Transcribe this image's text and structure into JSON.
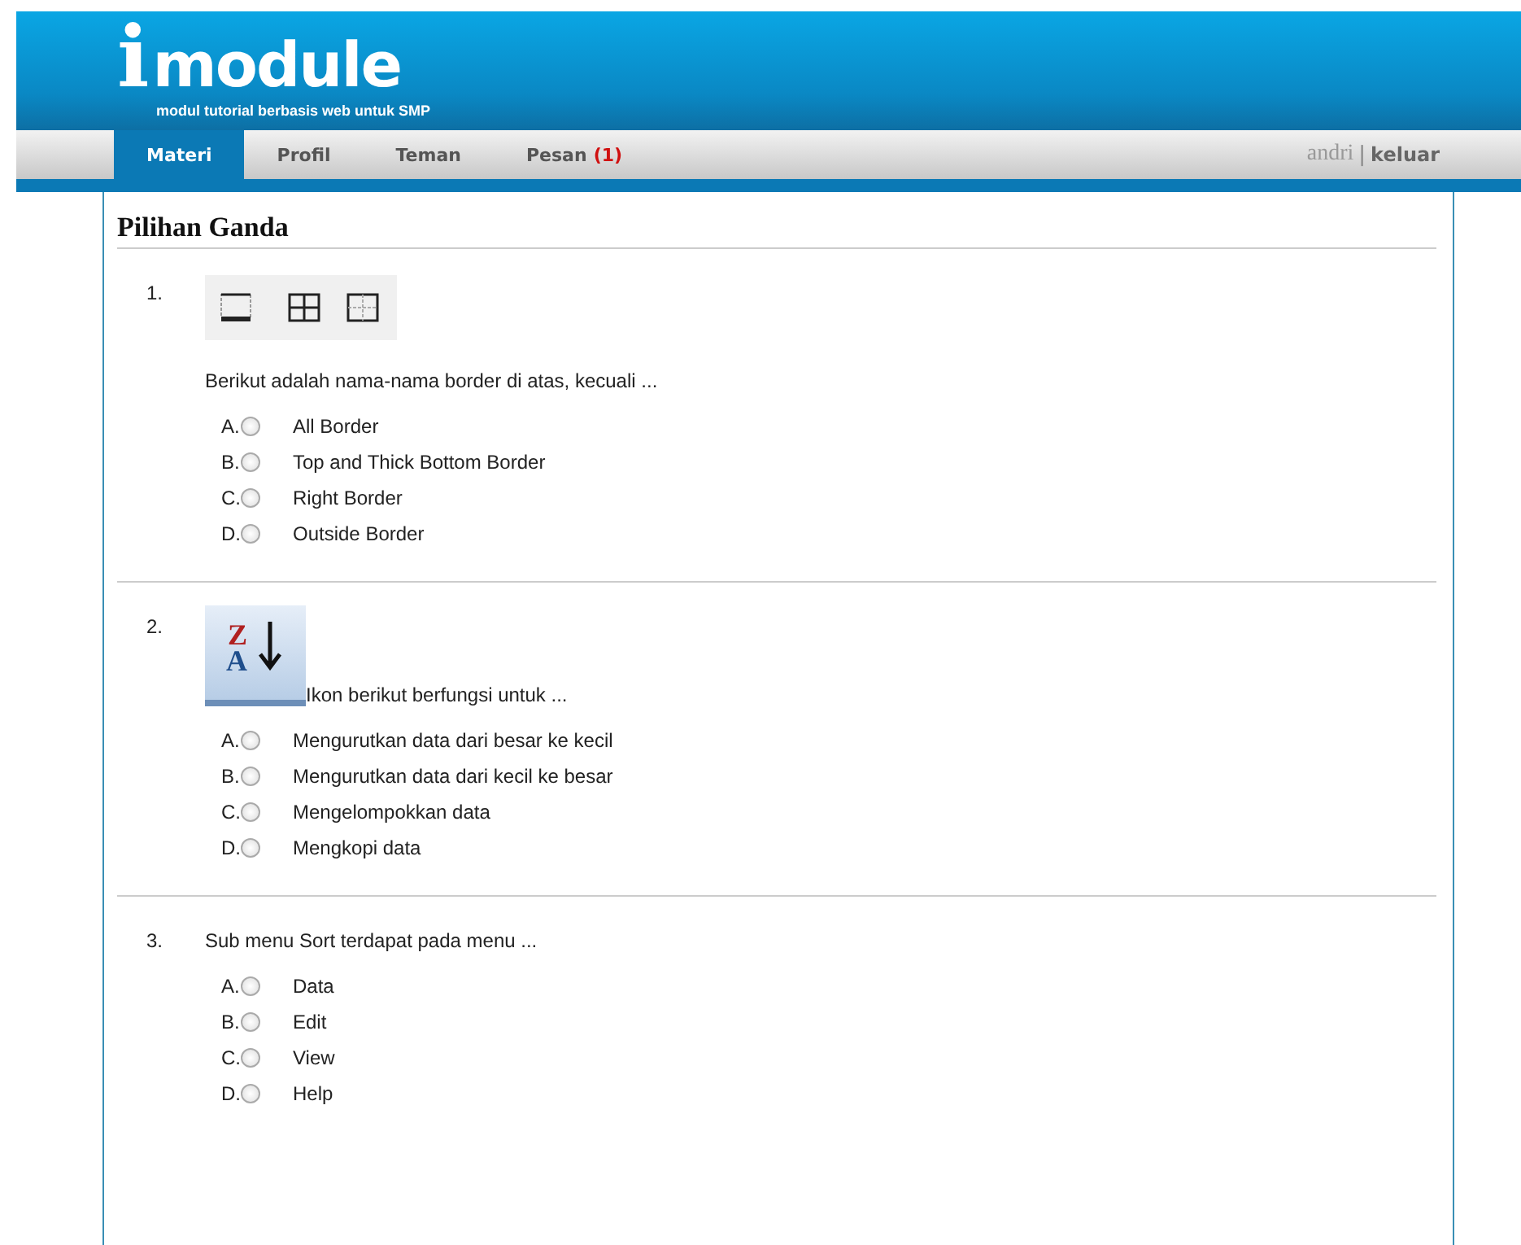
{
  "logo": {
    "letter": "i",
    "word": "module",
    "tagline": "modul tutorial berbasis web untuk SMP"
  },
  "nav": {
    "tabs": [
      {
        "label": "Materi",
        "selected": true
      },
      {
        "label": "Profil",
        "selected": false
      },
      {
        "label": "Teman",
        "selected": false
      },
      {
        "label": "Pesan",
        "count": "(1)",
        "selected": false
      }
    ],
    "user": "andri",
    "separator": "|",
    "logout": "keluar"
  },
  "section_title": "Pilihan Ganda",
  "questions": [
    {
      "number": "1.",
      "kind": "borders",
      "question": "Berikut adalah nama-nama border di atas, kecuali ...",
      "options": [
        {
          "letter": "A.",
          "text": "All Border",
          "selected": false
        },
        {
          "letter": "B.",
          "text": "Top and Thick Bottom Border",
          "selected": false
        },
        {
          "letter": "C.",
          "text": "Right Border",
          "selected": false
        },
        {
          "letter": "D.",
          "text": "Outside Border",
          "selected": false
        }
      ]
    },
    {
      "number": "2.",
      "kind": "sort",
      "icon_letters": [
        "Z",
        "A"
      ],
      "question": "Ikon berikut berfungsi untuk ...",
      "options": [
        {
          "letter": "A.",
          "text": "Mengurutkan data dari besar ke kecil",
          "selected": false
        },
        {
          "letter": "B.",
          "text": "Mengurutkan data dari kecil ke besar",
          "selected": false
        },
        {
          "letter": "C.",
          "text": "Mengelompokkan data",
          "selected": false
        },
        {
          "letter": "D.",
          "text": "Mengkopi data",
          "selected": false
        }
      ]
    },
    {
      "number": "3.",
      "question": "Sub menu Sort terdapat pada menu ...",
      "options": [
        {
          "letter": "A.",
          "text": "Data",
          "selected": false
        },
        {
          "letter": "B.",
          "text": "Edit",
          "selected": false
        },
        {
          "letter": "C.",
          "text": "View",
          "selected": false
        },
        {
          "letter": "D.",
          "text": "Help",
          "selected": false
        }
      ]
    }
  ]
}
